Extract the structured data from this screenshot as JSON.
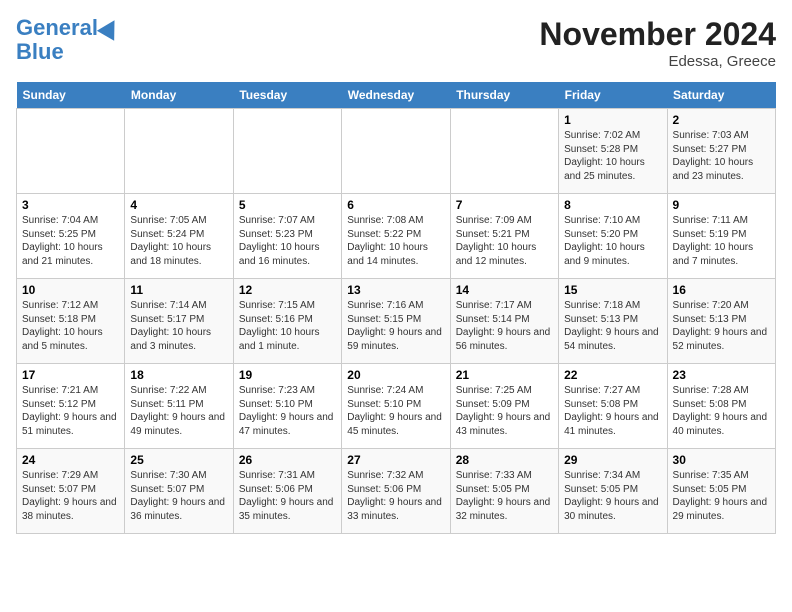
{
  "header": {
    "logo_line1": "General",
    "logo_line2": "Blue",
    "month": "November 2024",
    "location": "Edessa, Greece"
  },
  "weekdays": [
    "Sunday",
    "Monday",
    "Tuesday",
    "Wednesday",
    "Thursday",
    "Friday",
    "Saturday"
  ],
  "weeks": [
    [
      {
        "day": "",
        "info": ""
      },
      {
        "day": "",
        "info": ""
      },
      {
        "day": "",
        "info": ""
      },
      {
        "day": "",
        "info": ""
      },
      {
        "day": "",
        "info": ""
      },
      {
        "day": "1",
        "info": "Sunrise: 7:02 AM\nSunset: 5:28 PM\nDaylight: 10 hours and 25 minutes."
      },
      {
        "day": "2",
        "info": "Sunrise: 7:03 AM\nSunset: 5:27 PM\nDaylight: 10 hours and 23 minutes."
      }
    ],
    [
      {
        "day": "3",
        "info": "Sunrise: 7:04 AM\nSunset: 5:25 PM\nDaylight: 10 hours and 21 minutes."
      },
      {
        "day": "4",
        "info": "Sunrise: 7:05 AM\nSunset: 5:24 PM\nDaylight: 10 hours and 18 minutes."
      },
      {
        "day": "5",
        "info": "Sunrise: 7:07 AM\nSunset: 5:23 PM\nDaylight: 10 hours and 16 minutes."
      },
      {
        "day": "6",
        "info": "Sunrise: 7:08 AM\nSunset: 5:22 PM\nDaylight: 10 hours and 14 minutes."
      },
      {
        "day": "7",
        "info": "Sunrise: 7:09 AM\nSunset: 5:21 PM\nDaylight: 10 hours and 12 minutes."
      },
      {
        "day": "8",
        "info": "Sunrise: 7:10 AM\nSunset: 5:20 PM\nDaylight: 10 hours and 9 minutes."
      },
      {
        "day": "9",
        "info": "Sunrise: 7:11 AM\nSunset: 5:19 PM\nDaylight: 10 hours and 7 minutes."
      }
    ],
    [
      {
        "day": "10",
        "info": "Sunrise: 7:12 AM\nSunset: 5:18 PM\nDaylight: 10 hours and 5 minutes."
      },
      {
        "day": "11",
        "info": "Sunrise: 7:14 AM\nSunset: 5:17 PM\nDaylight: 10 hours and 3 minutes."
      },
      {
        "day": "12",
        "info": "Sunrise: 7:15 AM\nSunset: 5:16 PM\nDaylight: 10 hours and 1 minute."
      },
      {
        "day": "13",
        "info": "Sunrise: 7:16 AM\nSunset: 5:15 PM\nDaylight: 9 hours and 59 minutes."
      },
      {
        "day": "14",
        "info": "Sunrise: 7:17 AM\nSunset: 5:14 PM\nDaylight: 9 hours and 56 minutes."
      },
      {
        "day": "15",
        "info": "Sunrise: 7:18 AM\nSunset: 5:13 PM\nDaylight: 9 hours and 54 minutes."
      },
      {
        "day": "16",
        "info": "Sunrise: 7:20 AM\nSunset: 5:13 PM\nDaylight: 9 hours and 52 minutes."
      }
    ],
    [
      {
        "day": "17",
        "info": "Sunrise: 7:21 AM\nSunset: 5:12 PM\nDaylight: 9 hours and 51 minutes."
      },
      {
        "day": "18",
        "info": "Sunrise: 7:22 AM\nSunset: 5:11 PM\nDaylight: 9 hours and 49 minutes."
      },
      {
        "day": "19",
        "info": "Sunrise: 7:23 AM\nSunset: 5:10 PM\nDaylight: 9 hours and 47 minutes."
      },
      {
        "day": "20",
        "info": "Sunrise: 7:24 AM\nSunset: 5:10 PM\nDaylight: 9 hours and 45 minutes."
      },
      {
        "day": "21",
        "info": "Sunrise: 7:25 AM\nSunset: 5:09 PM\nDaylight: 9 hours and 43 minutes."
      },
      {
        "day": "22",
        "info": "Sunrise: 7:27 AM\nSunset: 5:08 PM\nDaylight: 9 hours and 41 minutes."
      },
      {
        "day": "23",
        "info": "Sunrise: 7:28 AM\nSunset: 5:08 PM\nDaylight: 9 hours and 40 minutes."
      }
    ],
    [
      {
        "day": "24",
        "info": "Sunrise: 7:29 AM\nSunset: 5:07 PM\nDaylight: 9 hours and 38 minutes."
      },
      {
        "day": "25",
        "info": "Sunrise: 7:30 AM\nSunset: 5:07 PM\nDaylight: 9 hours and 36 minutes."
      },
      {
        "day": "26",
        "info": "Sunrise: 7:31 AM\nSunset: 5:06 PM\nDaylight: 9 hours and 35 minutes."
      },
      {
        "day": "27",
        "info": "Sunrise: 7:32 AM\nSunset: 5:06 PM\nDaylight: 9 hours and 33 minutes."
      },
      {
        "day": "28",
        "info": "Sunrise: 7:33 AM\nSunset: 5:05 PM\nDaylight: 9 hours and 32 minutes."
      },
      {
        "day": "29",
        "info": "Sunrise: 7:34 AM\nSunset: 5:05 PM\nDaylight: 9 hours and 30 minutes."
      },
      {
        "day": "30",
        "info": "Sunrise: 7:35 AM\nSunset: 5:05 PM\nDaylight: 9 hours and 29 minutes."
      }
    ]
  ]
}
